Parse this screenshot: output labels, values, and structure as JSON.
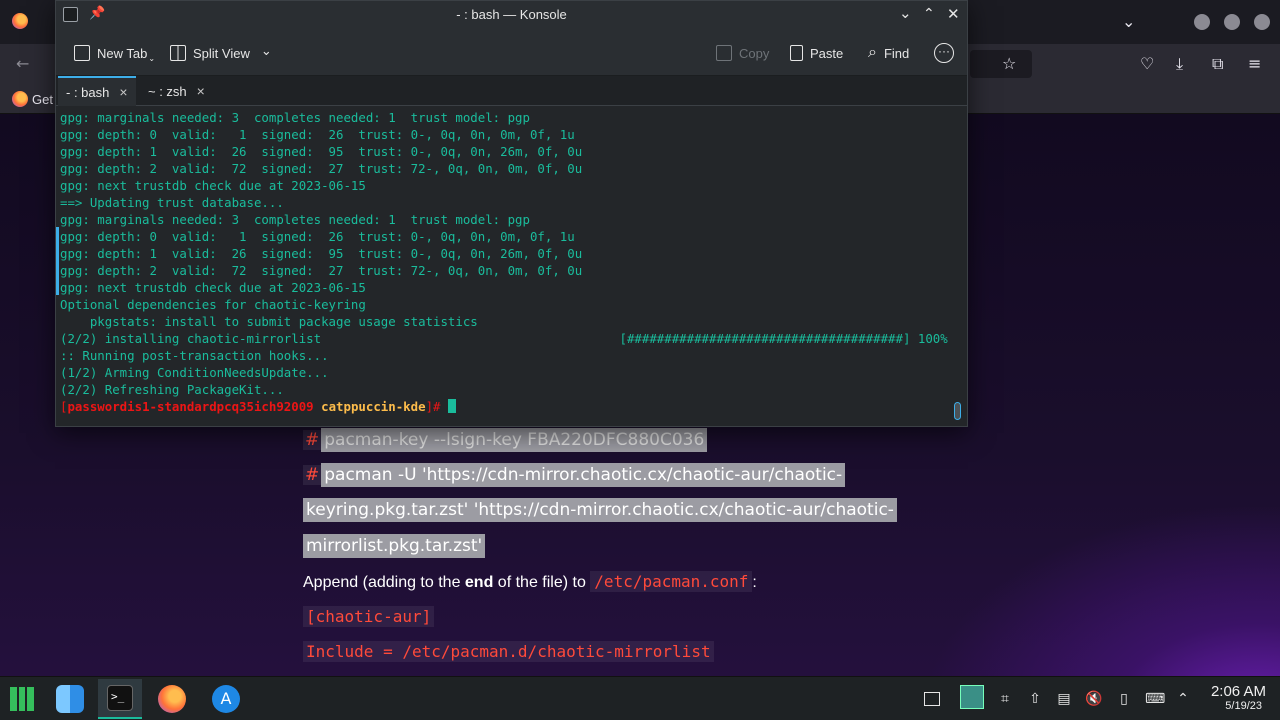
{
  "browser": {
    "bookmark_label": "Get",
    "article": {
      "code_line_1": "pacman-key --lsign-key FBA220DFC880C036",
      "code_line_2a": "pacman -U 'https://cdn-mirror.chaotic.cx/chaotic-aur/chaotic-",
      "code_line_2b": "keyring.pkg.tar.zst' 'https://cdn-mirror.chaotic.cx/chaotic-aur/chaotic-",
      "code_line_2c": "mirrorlist.pkg.tar.zst'",
      "hash": "#",
      "para_prefix": "Append (adding to the ",
      "para_bold": "end",
      "para_middle": " of the file) to ",
      "para_path": "/etc/pacman.conf",
      "para_suffix": ":",
      "section": "[chaotic-aur]",
      "include_line": "Include = /etc/pacman.d/chaotic-mirrorlist"
    }
  },
  "konsole": {
    "title": "- : bash — Konsole",
    "toolbar": {
      "new_tab": "New Tab",
      "split_view": "Split View",
      "copy": "Copy",
      "paste": "Paste",
      "find": "Find"
    },
    "tabs": [
      {
        "label": "- : bash",
        "close": "×"
      },
      {
        "label": "~ : zsh",
        "close": "×"
      }
    ],
    "lines": [
      "gpg: marginals needed: 3  completes needed: 1  trust model: pgp",
      "gpg: depth: 0  valid:   1  signed:  26  trust: 0-, 0q, 0n, 0m, 0f, 1u",
      "gpg: depth: 1  valid:  26  signed:  95  trust: 0-, 0q, 0n, 26m, 0f, 0u",
      "gpg: depth: 2  valid:  72  signed:  27  trust: 72-, 0q, 0n, 0m, 0f, 0u",
      "gpg: next trustdb check due at 2023-06-15",
      "==> Updating trust database...",
      "gpg: marginals needed: 3  completes needed: 1  trust model: pgp",
      "gpg: depth: 0  valid:   1  signed:  26  trust: 0-, 0q, 0n, 0m, 0f, 1u",
      "gpg: depth: 1  valid:  26  signed:  95  trust: 0-, 0q, 0n, 26m, 0f, 0u",
      "gpg: depth: 2  valid:  72  signed:  27  trust: 72-, 0q, 0n, 0m, 0f, 0u",
      "gpg: next trustdb check due at 2023-06-15",
      "Optional dependencies for chaotic-keyring",
      "    pkgstats: install to submit package usage statistics",
      "(2/2) installing chaotic-mirrorlist                                        [#####################################] 100%",
      ":: Running post-transaction hooks...",
      "(1/2) Arming ConditionNeedsUpdate...",
      "(2/2) Refreshing PackageKit..."
    ],
    "prompt": {
      "open": "[",
      "user_host": "passwordis1-standardpcq35ich92009",
      "dir": "catppuccin-kde",
      "close": "]# "
    }
  },
  "taskbar": {
    "time": "2:06 AM",
    "date": "5/19/23"
  },
  "colors": {
    "terminal_text": "#1abc9c",
    "terminal_bg": "#232629",
    "prompt": "#ed1515",
    "accent": "#3daee9",
    "article_code": "#ff4a3a"
  }
}
